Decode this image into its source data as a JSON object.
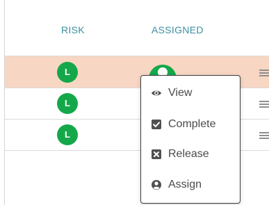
{
  "table": {
    "columns": {
      "risk": "RISK",
      "assigned": "ASSIGNED"
    },
    "rows": [
      {
        "risk": "L",
        "selected": true
      },
      {
        "risk": "L",
        "selected": false
      },
      {
        "risk": "L",
        "selected": false
      }
    ]
  },
  "context_menu": {
    "items": [
      {
        "label": "View",
        "icon": "eye-icon"
      },
      {
        "label": "Complete",
        "icon": "checkbox-checked-icon"
      },
      {
        "label": "Release",
        "icon": "checkbox-x-icon"
      },
      {
        "label": "Assign",
        "icon": "user-circle-icon"
      }
    ]
  },
  "colors": {
    "header_text": "#3a8fa0",
    "risk_low": "#14a84a",
    "selected_row": "#f7d6c3",
    "menu_icon": "#505050"
  }
}
